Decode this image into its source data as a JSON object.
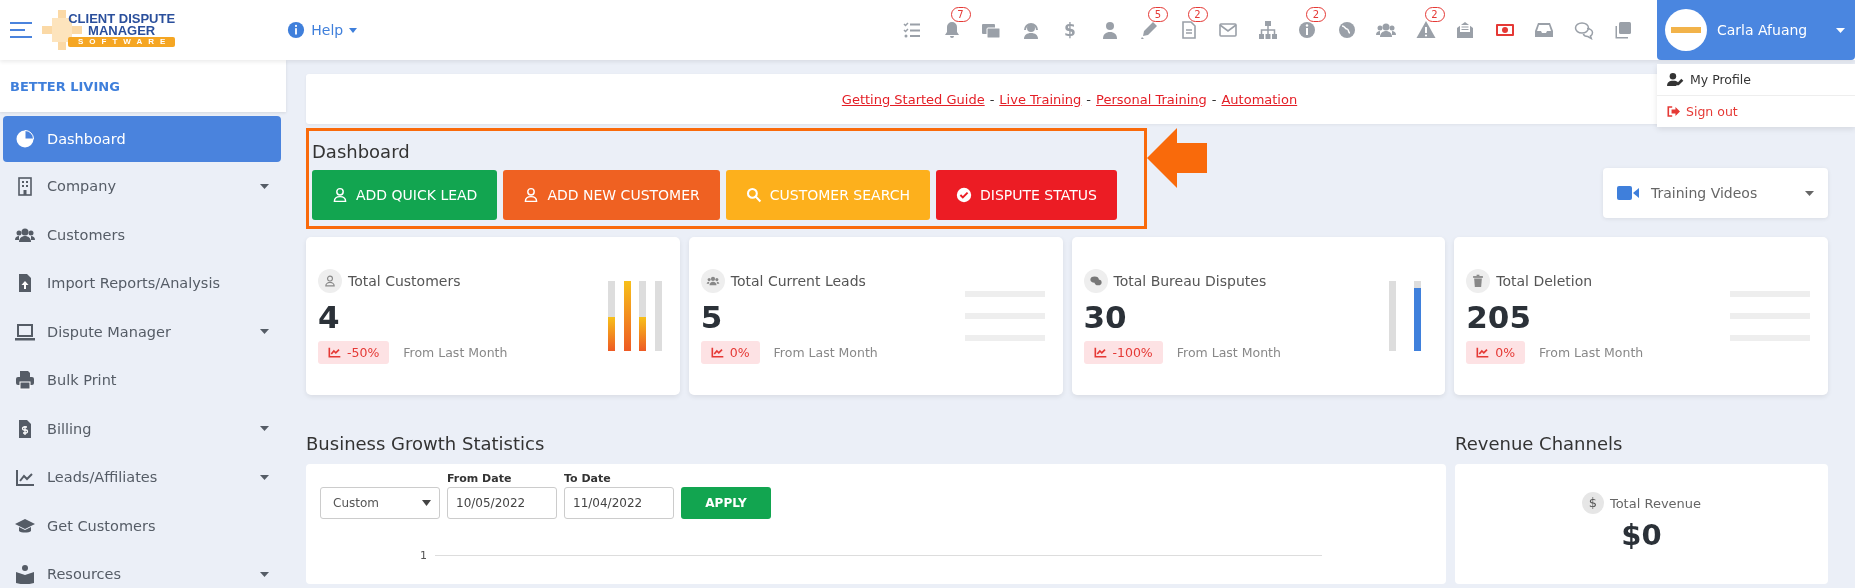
{
  "header": {
    "logo": {
      "line_1": "CLIENT DISPUTE",
      "line_2": "MANAGER",
      "line_3": "SOFTWARE"
    },
    "help": "Help",
    "toolbar": [
      {
        "kind": "icon"
      },
      {
        "kind": "icon",
        "badge": "7"
      },
      {
        "kind": "icon"
      },
      {
        "kind": "icon"
      },
      {
        "kind": "glyph",
        "glyph": "$"
      },
      {
        "kind": "icon"
      },
      {
        "kind": "icon",
        "badge": "5"
      },
      {
        "kind": "icon",
        "badge": "2"
      },
      {
        "kind": "icon"
      },
      {
        "kind": "icon"
      },
      {
        "kind": "icon",
        "badge": "2"
      },
      {
        "kind": "icon"
      },
      {
        "kind": "icon"
      },
      {
        "kind": "icon",
        "badge": "2"
      },
      {
        "kind": "icon"
      },
      {
        "kind": "icon"
      },
      {
        "kind": "icon"
      },
      {
        "kind": "icon"
      },
      {
        "kind": "icon"
      }
    ],
    "user": {
      "name": "Carla Afuang"
    },
    "user_menu": [
      {
        "label": "My Profile",
        "kind": "profile"
      },
      {
        "label": "Sign out",
        "kind": "signout"
      }
    ]
  },
  "sidebar": {
    "company": "BETTER LIVING",
    "items": [
      {
        "label": "Dashboard",
        "selected": true,
        "submenu": false
      },
      {
        "label": "Company",
        "selected": false,
        "submenu": true
      },
      {
        "label": "Customers",
        "selected": false,
        "submenu": false
      },
      {
        "label": "Import Reports/Analysis",
        "selected": false,
        "submenu": false
      },
      {
        "label": "Dispute Manager",
        "selected": false,
        "submenu": true
      },
      {
        "label": "Bulk Print",
        "selected": false,
        "submenu": false
      },
      {
        "label": "Billing",
        "selected": false,
        "submenu": true
      },
      {
        "label": "Leads/Affiliates",
        "selected": false,
        "submenu": true
      },
      {
        "label": "Get Customers",
        "selected": false,
        "submenu": false
      },
      {
        "label": "Resources",
        "selected": false,
        "submenu": true
      }
    ]
  },
  "links": {
    "items": [
      "Getting Started Guide",
      "Live Training",
      "Personal Training",
      "Automation"
    ],
    "separator": "-"
  },
  "dashboard": {
    "title": "Dashboard",
    "buttons": [
      {
        "label": "ADD QUICK LEAD",
        "kind": "lead"
      },
      {
        "label": "ADD NEW CUSTOMER",
        "kind": "customer"
      },
      {
        "label": "CUSTOMER SEARCH",
        "kind": "search"
      },
      {
        "label": "DISPUTE STATUS",
        "kind": "status"
      }
    ],
    "training_videos": "Training Videos"
  },
  "cards": [
    {
      "title": "Total Customers",
      "value": "4",
      "change": "-50%",
      "note": "From Last Month",
      "kind": "warm"
    },
    {
      "title": "Total Current Leads",
      "value": "5",
      "change": "0%",
      "note": "From Last Month",
      "kind": "lines"
    },
    {
      "title": "Total Bureau Disputes",
      "value": "30",
      "change": "-100%",
      "note": "From Last Month",
      "kind": "cool"
    },
    {
      "title": "Total Deletion",
      "value": "205",
      "change": "0%",
      "note": "From Last Month",
      "kind": "lines"
    }
  ],
  "growth": {
    "title": "Business Growth Statistics",
    "range": "Custom",
    "from_label": "From Date",
    "from": "10/05/2022",
    "to_label": "To Date",
    "to": "11/04/2022",
    "apply": "APPLY",
    "axis_tick": "1"
  },
  "revenue": {
    "title": "Revenue Channels",
    "glyph": "$",
    "label": "Total Revenue",
    "value": "$0"
  }
}
